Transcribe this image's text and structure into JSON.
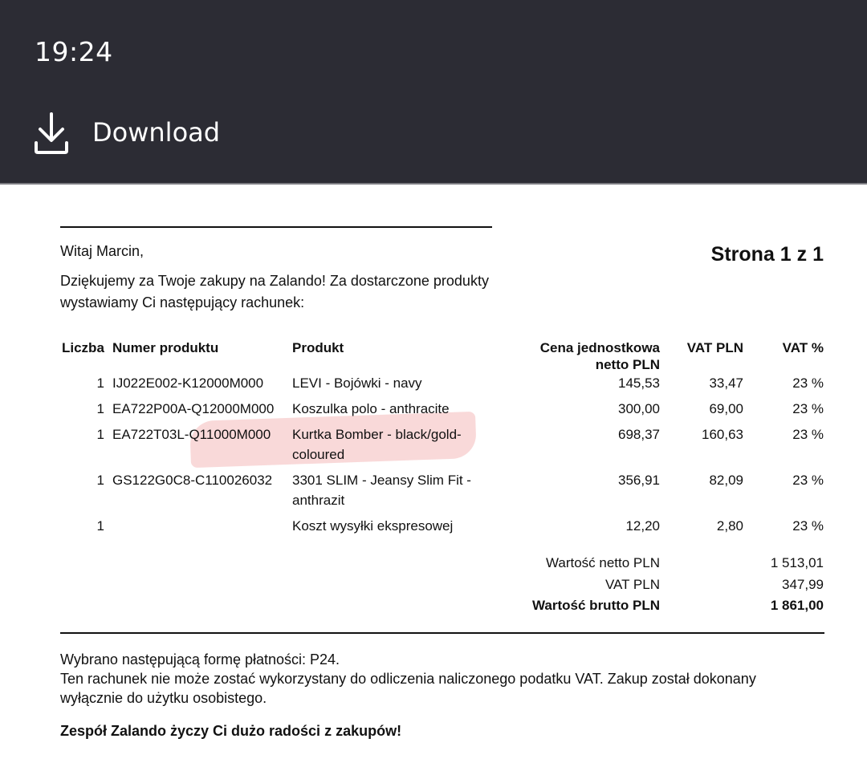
{
  "status_bar": {
    "time": "19:24"
  },
  "toolbar": {
    "download_label": "Download",
    "download_icon": "download-icon"
  },
  "colors": {
    "toolbar_bg": "#2c2c34",
    "highlight": "#f4b4b4"
  },
  "invoice": {
    "greeting": "Witaj Marcin,",
    "page": "Strona 1 z 1",
    "intro_line1": "Dziękujemy za Twoje zakupy na Zalando! Za dostarczone produkty",
    "intro_line2": "wystawiamy Ci następujący rachunek:",
    "headers": {
      "qty": "Liczba",
      "product_no": "Numer produktu",
      "product": "Produkt",
      "unit_price_line1": "Cena jednostkowa",
      "unit_price_line2": "netto PLN",
      "vat_pln": "VAT PLN",
      "vat_pct": "VAT %"
    },
    "rows": [
      {
        "qty": "1",
        "product_no": "IJ022E002-K12000M000",
        "product_line1": "LEVI - Bojówki - navy",
        "product_line2": "",
        "price": "145,53",
        "vat": "33,47",
        "vat_pct": "23 %"
      },
      {
        "qty": "1",
        "product_no": "EA722P00A-Q12000M000",
        "product_line1": "Koszulka polo - anthracite",
        "product_line2": "",
        "price": "300,00",
        "vat": "69,00",
        "vat_pct": "23 %"
      },
      {
        "qty": "1",
        "product_no": "EA722T03L-Q11000M000",
        "product_line1": "Kurtka Bomber - black/gold-",
        "product_line2": "coloured",
        "price": "698,37",
        "vat": "160,63",
        "vat_pct": "23 %"
      },
      {
        "qty": "1",
        "product_no": "GS122G0C8-C110026032",
        "product_line1": "3301 SLIM - Jeansy Slim Fit -",
        "product_line2": "anthrazit",
        "price": "356,91",
        "vat": "82,09",
        "vat_pct": "23 %"
      },
      {
        "qty": "1",
        "product_no": "",
        "product_line1": "Koszt wysyłki ekspresowej",
        "product_line2": "",
        "price": "12,20",
        "vat": "2,80",
        "vat_pct": "23 %"
      }
    ],
    "totals": {
      "net_label": "Wartość netto PLN",
      "net_value": "1 513,01",
      "vat_label": "VAT PLN",
      "vat_value": "347,99",
      "gross_label": "Wartość brutto PLN",
      "gross_value": "1 861,00"
    },
    "payment_line": "Wybrano następującą formę płatności: P24.",
    "notice": "Ten rachunek nie może zostać wykorzystany do odliczenia naliczonego podatku VAT. Zakup został dokonany wyłącznie do użytku osobistego.",
    "closing": "Zespół Zalando życzy Ci dużo radości z zakupów!"
  }
}
